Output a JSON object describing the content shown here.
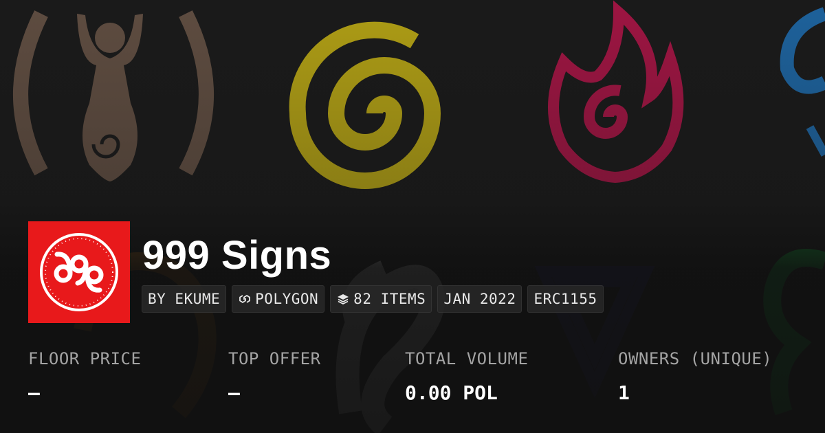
{
  "collection": {
    "name": "999 Signs",
    "logo_text": "999"
  },
  "badges": [
    {
      "label": "BY EKUME",
      "icon": ""
    },
    {
      "label": "POLYGON",
      "icon": "polygon-chain-icon"
    },
    {
      "label": "82 ITEMS",
      "icon": "layers-icon"
    },
    {
      "label": "JAN 2022",
      "icon": ""
    },
    {
      "label": "ERC1155",
      "icon": ""
    }
  ],
  "stats": [
    {
      "label": "FLOOR PRICE",
      "value": "–"
    },
    {
      "label": "TOP OFFER",
      "value": "–"
    },
    {
      "label": "TOTAL VOLUME",
      "value": "0.00 POL"
    },
    {
      "label": "OWNERS (UNIQUE)",
      "value": "1"
    }
  ],
  "colors": {
    "logo_background": "#e8191b",
    "spiral": "#c9b515",
    "flame": "#b5154a",
    "goddess": "#6b5648",
    "water": "#1f6fb3",
    "leaf": "#137a2e"
  }
}
